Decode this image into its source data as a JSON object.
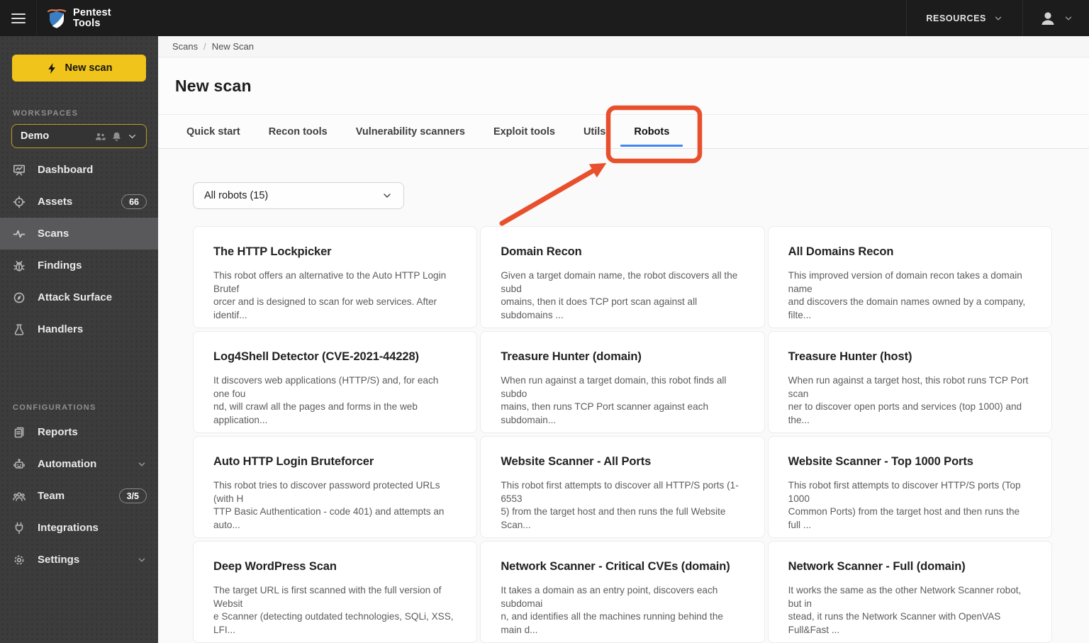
{
  "header": {
    "brand": {
      "line1": "Pentest",
      "line2": "Tools"
    },
    "resources_label": "RESOURCES"
  },
  "sidebar": {
    "new_scan_button": "New scan",
    "workspaces_label": "WORKSPACES",
    "workspace": {
      "name": "Demo"
    },
    "nav": [
      {
        "label": "Dashboard"
      },
      {
        "label": "Assets",
        "badge": "66"
      },
      {
        "label": "Scans",
        "active": true
      },
      {
        "label": "Findings"
      },
      {
        "label": "Attack Surface"
      },
      {
        "label": "Handlers"
      }
    ],
    "configurations_label": "CONFIGURATIONS",
    "config_nav": [
      {
        "label": "Reports"
      },
      {
        "label": "Automation",
        "expandable": true
      },
      {
        "label": "Team",
        "badge": "3/5"
      },
      {
        "label": "Integrations"
      },
      {
        "label": "Settings",
        "expandable": true
      }
    ]
  },
  "breadcrumb": {
    "items": [
      "Scans",
      "New Scan"
    ],
    "separator": "/"
  },
  "page": {
    "title": "New scan"
  },
  "tabs": [
    {
      "label": "Quick start"
    },
    {
      "label": "Recon tools"
    },
    {
      "label": "Vulnerability scanners"
    },
    {
      "label": "Exploit tools"
    },
    {
      "label": "Utils"
    },
    {
      "label": "Robots",
      "active": true
    }
  ],
  "filter": {
    "value": "All robots (15)"
  },
  "robots": [
    {
      "title": "The HTTP Lockpicker",
      "description": "This robot offers an alternative to the Auto HTTP Login Brutef\norcer and is designed to scan for web services. After identif..."
    },
    {
      "title": "Domain Recon",
      "description": "Given a target domain name, the robot discovers all the subd\nomains, then it does TCP port scan against all subdomains ..."
    },
    {
      "title": "All Domains Recon",
      "description": "This improved version of domain recon takes a domain name\nand discovers the domain names owned by a company, filte..."
    },
    {
      "title": "Log4Shell Detector (CVE-2021-44228)",
      "description": "It discovers web applications (HTTP/S) and, for each one fou\nnd, will crawl all the pages and forms in the web application..."
    },
    {
      "title": "Treasure Hunter (domain)",
      "description": "When run against a target domain, this robot finds all subdo\nmains, then runs TCP Port scanner against each subdomain..."
    },
    {
      "title": "Treasure Hunter (host)",
      "description": "When run against a target host, this robot runs TCP Port scan\nner to discover open ports and services (top 1000) and the..."
    },
    {
      "title": "Auto HTTP Login Bruteforcer",
      "description": "This robot tries to discover password protected URLs (with H\nTTP Basic Authentication - code 401) and attempts an auto..."
    },
    {
      "title": "Website Scanner - All Ports",
      "description": "This robot first attempts to discover all HTTP/S ports (1-6553\n5) from the target host and then runs the full Website Scan..."
    },
    {
      "title": "Website Scanner - Top 1000 Ports",
      "description": "This robot first attempts to discover HTTP/S ports (Top 1000\nCommon Ports) from the target host and then runs the full ..."
    },
    {
      "title": "Deep WordPress Scan",
      "description": "The target URL is first scanned with the full version of Websit\ne Scanner (detecting outdated technologies, SQLi, XSS, LFI..."
    },
    {
      "title": "Network Scanner - Critical CVEs (domain)",
      "description": "It takes a domain as an entry point, discovers each subdomai\nn, and identifies all the machines running behind the main d..."
    },
    {
      "title": "Network Scanner - Full (domain)",
      "description": "It works the same as the other Network Scanner robot, but in\nstead, it runs the Network Scanner with OpenVAS Full&Fast ..."
    }
  ],
  "colors": {
    "accent_yellow": "#f0c41b",
    "annotation_red": "#e8502d",
    "active_tab_blue": "#4285f4",
    "sidebar_bg": "#3c3c3c",
    "header_bg": "#1c1c1c"
  }
}
